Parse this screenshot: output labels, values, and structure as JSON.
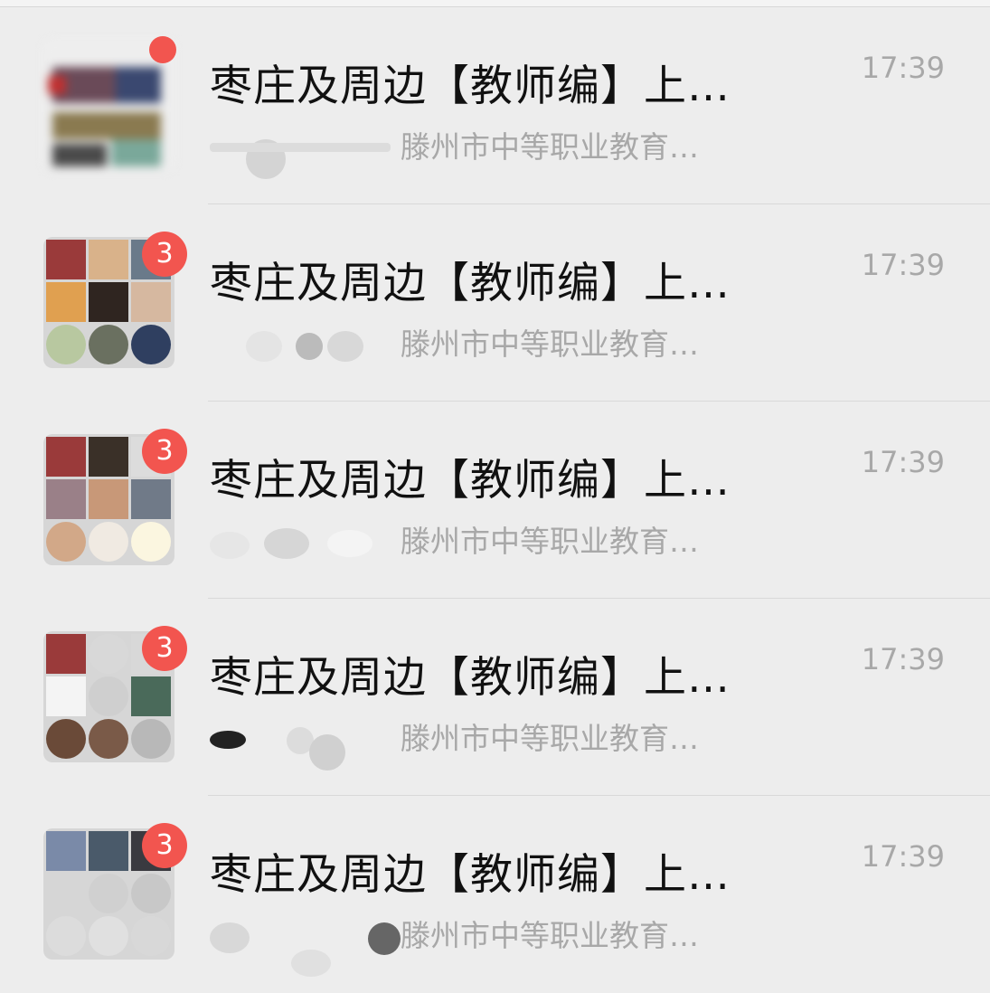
{
  "chats": [
    {
      "title": "枣庄及周边【教师编】上…",
      "time": "17:39",
      "preview": "滕州市中等职业教育…",
      "badge": ""
    },
    {
      "title": "枣庄及周边【教师编】上…",
      "time": "17:39",
      "preview": "滕州市中等职业教育…",
      "badge": "3"
    },
    {
      "title": "枣庄及周边【教师编】上…",
      "time": "17:39",
      "preview": "滕州市中等职业教育…",
      "badge": "3"
    },
    {
      "title": "枣庄及周边【教师编】上…",
      "time": "17:39",
      "preview": "滕州市中等职业教育…",
      "badge": "3"
    },
    {
      "title": "枣庄及周边【教师编】上…",
      "time": "17:39",
      "preview": "滕州市中等职业教育…",
      "badge": "3"
    }
  ],
  "colors": {
    "badge": "#f2554f",
    "background": "#ededed",
    "title": "#111111",
    "muted": "#a8a8a8"
  },
  "icons": {
    "unread_badge": "unread-count-badge",
    "avatar": "group-avatar-icon"
  }
}
